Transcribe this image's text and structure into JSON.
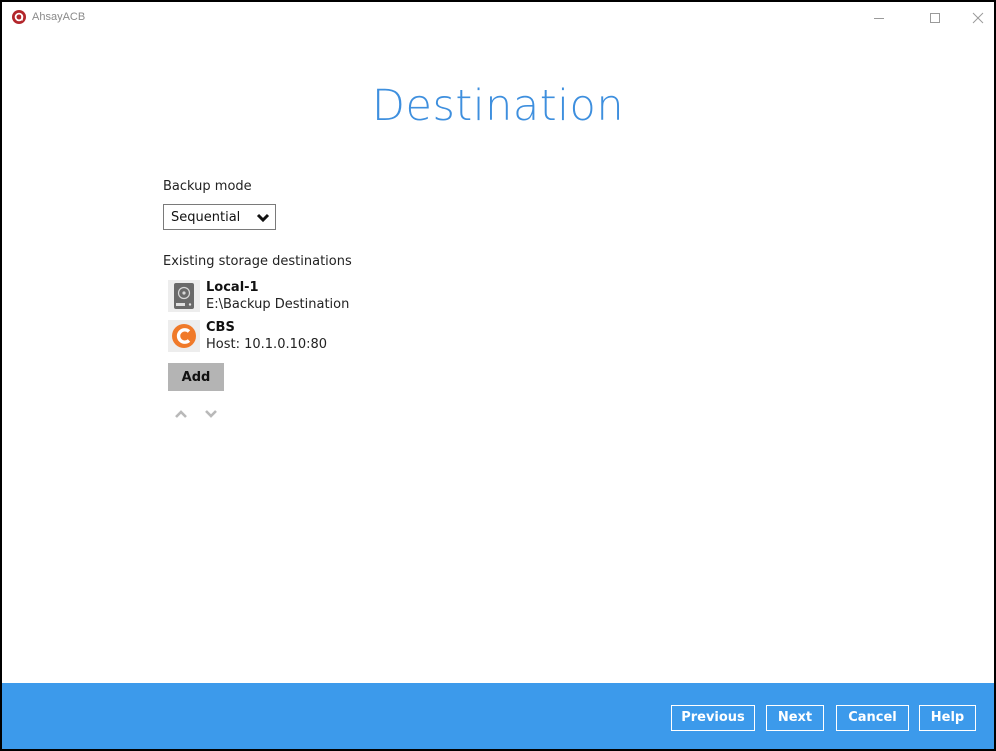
{
  "window": {
    "app_title": "AhsayACB"
  },
  "page": {
    "title": "Destination"
  },
  "backup_mode": {
    "label": "Backup mode",
    "selected": "Sequential"
  },
  "destinations": {
    "label": "Existing storage destinations",
    "items": [
      {
        "name": "Local-1",
        "detail": "E:\\Backup Destination",
        "icon": "hard-drive-icon"
      },
      {
        "name": "CBS",
        "detail": "Host: 10.1.0.10:80",
        "icon": "cbs-logo-icon"
      }
    ],
    "add_label": "Add"
  },
  "footer": {
    "previous": "Previous",
    "next": "Next",
    "cancel": "Cancel",
    "help": "Help"
  },
  "colors": {
    "accent": "#3e8fde",
    "footer_bg": "#3c9aeb",
    "app_logo": "#b3262b",
    "cbs_orange": "#f07a2a"
  }
}
